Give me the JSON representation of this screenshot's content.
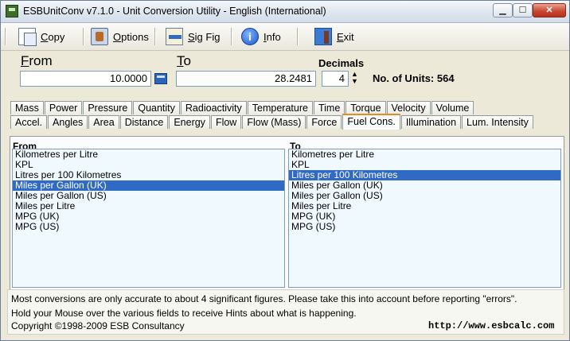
{
  "window": {
    "title": "ESBUnitConv v7.1.0 - Unit Conversion Utility - English (International)"
  },
  "toolbar": [
    {
      "label": "Copy",
      "accel": "C",
      "rest": "opy",
      "icon": "copy-icon"
    },
    {
      "label": "Options",
      "accel": "O",
      "rest": "ptions",
      "icon": "options-icon"
    },
    {
      "label": "Sig Fig",
      "accel": "S",
      "rest": "ig Fig",
      "icon": "sig-fig-icon"
    },
    {
      "label": "Info",
      "accel": "I",
      "rest": "nfo",
      "icon": "info-icon"
    },
    {
      "label": "Exit",
      "accel": "E",
      "rest": "xit",
      "icon": "exit-icon"
    }
  ],
  "conversion": {
    "from_label": "From",
    "from_accel": "F",
    "from_rest": "rom",
    "to_label": "To",
    "to_accel": "T",
    "to_rest": "o",
    "from_value": "10.0000",
    "to_value": "28.2481",
    "decimals_label": "Decimals",
    "decimals_value": "4",
    "units_count": "No. of Units: 564"
  },
  "tabs_row1": [
    "Mass",
    "Power",
    "Pressure",
    "Quantity",
    "Radioactivity",
    "Temperature",
    "Time",
    "Torque",
    "Velocity",
    "Volume"
  ],
  "tabs_row2": [
    "Accel.",
    "Angles",
    "Area",
    "Distance",
    "Energy",
    "Flow",
    "Flow (Mass)",
    "Force",
    "Fuel Cons.",
    "Illumination",
    "Lum. Intensity"
  ],
  "active_tab": "Fuel Cons.",
  "from_list": {
    "header": "From",
    "items": [
      "Kilometres per Litre",
      "KPL",
      "Litres per 100 Kilometres",
      "Miles per Gallon (UK)",
      "Miles per Gallon (US)",
      "Miles per Litre",
      "MPG (UK)",
      "MPG (US)"
    ],
    "selected": 3
  },
  "to_list": {
    "header": "To",
    "items": [
      "Kilometres per Litre",
      "KPL",
      "Litres per 100 Kilometres",
      "Miles per Gallon (UK)",
      "Miles per Gallon (US)",
      "Miles per Litre",
      "MPG (UK)",
      "MPG (US)"
    ],
    "selected": 2
  },
  "footer": {
    "line1": "Most conversions are only accurate to about 4 significant figures. Please take this into account before reporting \"errors\".",
    "line2": "Hold your Mouse over the various fields to receive Hints about what is happening.",
    "copyright": "Copyright ©1998-2009 ESB Consultancy",
    "url": "http://www.esbcalc.com"
  },
  "colors": {
    "selection": "#316ac5",
    "tab_highlight": "#e68b2c",
    "list_bg": "#f0fafe"
  }
}
